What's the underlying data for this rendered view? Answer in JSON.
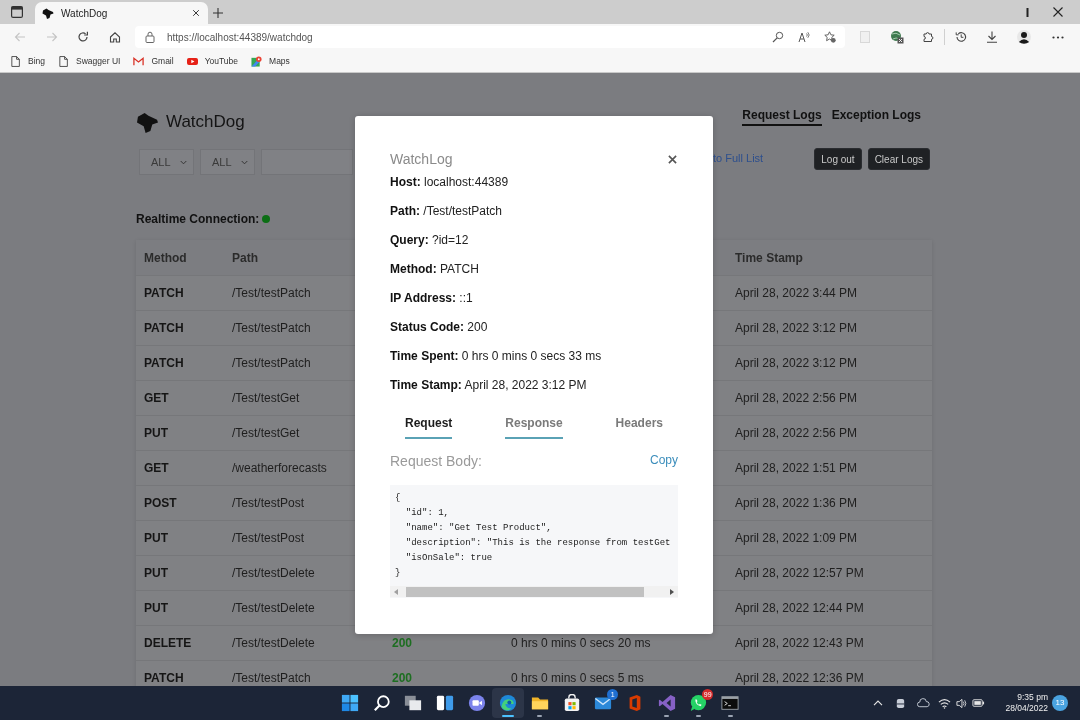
{
  "browser": {
    "tabs": [
      {
        "title": "WatchDog",
        "selected": true
      }
    ],
    "address": "https://localhost:44389/watchdog",
    "bookmarks": [
      {
        "label": "Bing",
        "kind": "page"
      },
      {
        "label": "Swagger UI",
        "kind": "page"
      },
      {
        "label": "Gmail",
        "kind": "gmail"
      },
      {
        "label": "YouTube",
        "kind": "youtube"
      },
      {
        "label": "Maps",
        "kind": "maps"
      }
    ]
  },
  "page": {
    "brand": "WatchDog",
    "nav": [
      {
        "label": "Request Logs",
        "selected": true
      },
      {
        "label": "Exception Logs",
        "selected": false
      }
    ],
    "filters": [
      {
        "value": "ALL"
      },
      {
        "value": "ALL"
      }
    ],
    "link": "to Full List",
    "buttons": [
      "Log out",
      "Clear Logs"
    ],
    "connection": {
      "label": "Realtime Connection:",
      "connected": true
    },
    "table": {
      "columns": [
        "Method",
        "Path",
        "Time Stamp"
      ],
      "rows": [
        {
          "method": "PATCH",
          "path": "/Test/testPatch",
          "time_stamp": "April 28, 2022 3:44 PM"
        },
        {
          "method": "PATCH",
          "path": "/Test/testPatch",
          "time_stamp": "April 28, 2022 3:12 PM"
        },
        {
          "method": "PATCH",
          "path": "/Test/testPatch",
          "time_stamp": "April 28, 2022 3:12 PM"
        },
        {
          "method": "GET",
          "path": "/Test/testGet",
          "time_stamp": "April 28, 2022 2:56 PM"
        },
        {
          "method": "PUT",
          "path": "/Test/testGet",
          "time_stamp": "April 28, 2022 2:56 PM"
        },
        {
          "method": "GET",
          "path": "/weatherforecasts",
          "time_stamp": "April 28, 2022 1:51 PM"
        },
        {
          "method": "POST",
          "path": "/Test/testPost",
          "time_stamp": "April 28, 2022 1:36 PM"
        },
        {
          "method": "PUT",
          "path": "/Test/testPost",
          "time_stamp": "April 28, 2022 1:09 PM"
        },
        {
          "method": "PUT",
          "path": "/Test/testDelete",
          "time_stamp": "April 28, 2022 12:57 PM"
        },
        {
          "method": "PUT",
          "path": "/Test/testDelete",
          "time_stamp": "April 28, 2022 12:44 PM"
        },
        {
          "method": "DELETE",
          "path": "/Test/testDelete",
          "column_3": "200",
          "column_4": "0 hrs 0 mins 0 secs 20 ms",
          "time_stamp": "April 28, 2022 12:43 PM"
        },
        {
          "method": "PATCH",
          "path": "/Test/testPatch",
          "column_3": "200",
          "column_4": "0 hrs 0 mins 0 secs 5 ms",
          "time_stamp": "April 28, 2022 12:36 PM"
        }
      ]
    }
  },
  "modal": {
    "title": "WatchLog",
    "fields": [
      "**Host:** localhost:44389",
      "**Path:** /Test/testPatch",
      "**Query:** ?id=12",
      "**Method:** PATCH",
      "**IP Address:** ::1",
      "**Status Code:** 200",
      "**Time Spent:** 0 hrs 0 mins 0 secs 33 ms",
      "**Time Stamp:** April 28, 2022 3:12 PM"
    ],
    "tabs": [
      {
        "label": "Request",
        "selected": true,
        "underlined": true
      },
      {
        "label": "Response",
        "selected": false,
        "underlined": true
      },
      {
        "label": "Headers",
        "selected": false,
        "underlined": false
      }
    ],
    "body_title": "Request Body:",
    "copy": "Copy",
    "body_lines": [
      "{",
      "  \"id\": 1,",
      "  \"name\": \"Get Test Product\",",
      "  \"description\": \"This is the response from testGet",
      "  \"isOnSale\": true",
      "}"
    ]
  },
  "taskbar": {
    "apps": [
      {
        "kind": "start",
        "running": false,
        "selected": false
      },
      {
        "kind": "search",
        "running": false,
        "selected": false
      },
      {
        "kind": "task-view",
        "running": false,
        "selected": false
      },
      {
        "kind": "widgets",
        "running": false,
        "selected": false
      },
      {
        "kind": "chat",
        "running": false,
        "selected": false
      },
      {
        "kind": "edge",
        "running": true,
        "selected": true
      },
      {
        "kind": "explorer",
        "running": true,
        "selected": false
      },
      {
        "kind": "store",
        "running": false,
        "selected": false
      },
      {
        "kind": "mail",
        "running": false,
        "selected": false,
        "badge": "1"
      },
      {
        "kind": "office",
        "running": false,
        "selected": false
      },
      {
        "kind": "studio",
        "running": true,
        "selected": false
      },
      {
        "kind": "whatsapp",
        "running": true,
        "selected": false,
        "badge": "99"
      },
      {
        "kind": "terminal",
        "running": true,
        "selected": false
      }
    ],
    "time": "9:35 pm",
    "date": "28/04/2022",
    "notifications": "13"
  }
}
